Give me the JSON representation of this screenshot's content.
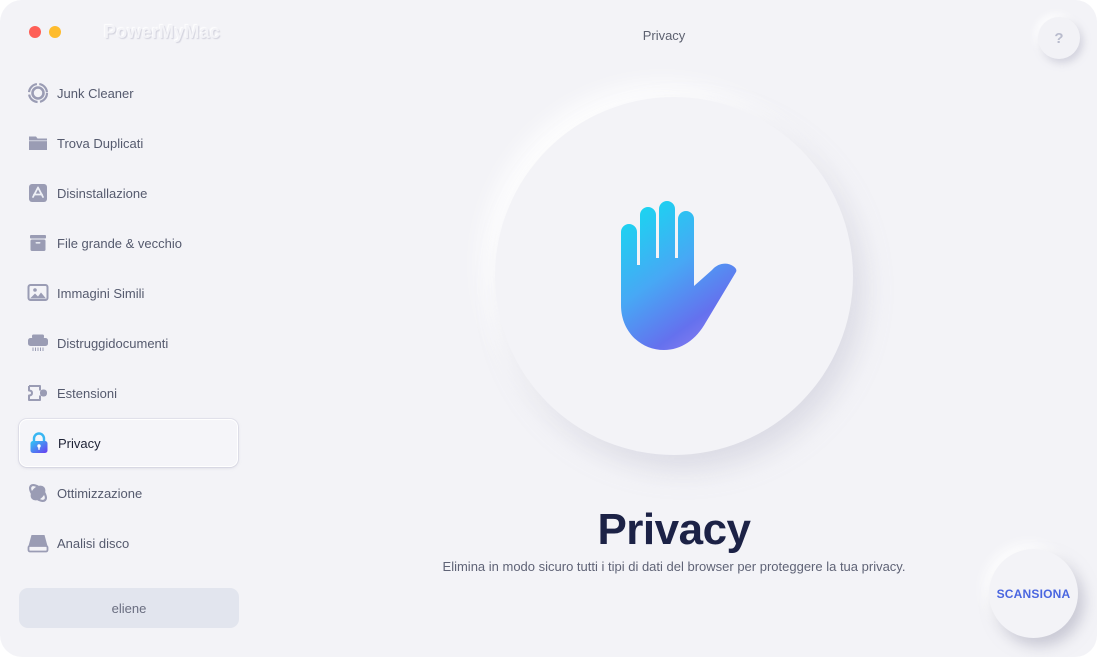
{
  "app": {
    "name": "PowerMyMac",
    "window_title": "Privacy",
    "help_label": "?"
  },
  "sidebar": {
    "items": [
      {
        "label": "Junk Cleaner",
        "icon": "junk-cleaner-icon",
        "active": false
      },
      {
        "label": "Trova Duplicati",
        "icon": "folder-icon",
        "active": false
      },
      {
        "label": "Disinstallazione",
        "icon": "app-store-icon",
        "active": false
      },
      {
        "label": "File grande & vecchio",
        "icon": "archive-box-icon",
        "active": false
      },
      {
        "label": "Immagini Simili",
        "icon": "image-icon",
        "active": false
      },
      {
        "label": "Distruggidocumenti",
        "icon": "shredder-icon",
        "active": false
      },
      {
        "label": "Estensioni",
        "icon": "puzzle-plug-icon",
        "active": false
      },
      {
        "label": "Privacy",
        "icon": "lock-icon",
        "active": true
      },
      {
        "label": "Ottimizzazione",
        "icon": "orbit-icon",
        "active": false
      },
      {
        "label": "Analisi disco",
        "icon": "disk-icon",
        "active": false
      }
    ],
    "user": "eliene"
  },
  "main": {
    "title": "Privacy",
    "description": "Elimina in modo sicuro tutti i tipi di dati del browser per proteggere la tua privacy.",
    "scan_button": "SCANSIONA",
    "hero_icon": "hand-stop-icon"
  },
  "colors": {
    "background": "#f3f3f7",
    "accent": "#4a66e0",
    "title": "#1c2246",
    "icon_gray": "#9a9cb4",
    "close": "#fe5f57",
    "minimize": "#febc2e"
  }
}
